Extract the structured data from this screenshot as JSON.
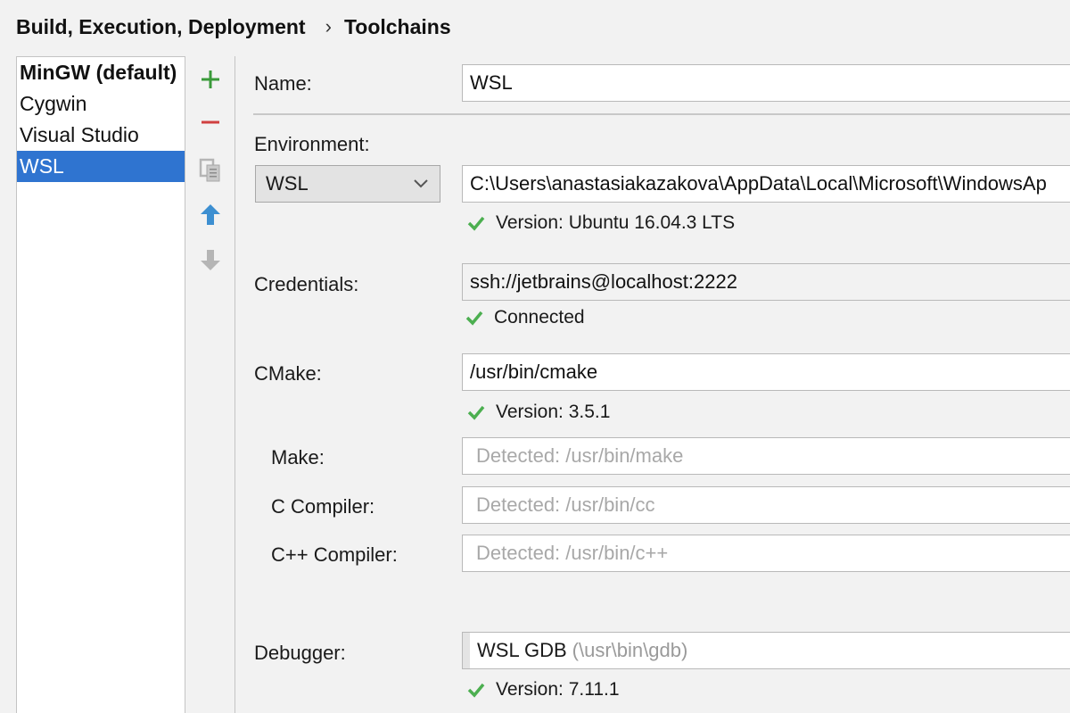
{
  "breadcrumb": {
    "parent": "Build, Execution, Deployment",
    "separator": "›",
    "current": "Toolchains"
  },
  "toolchains": [
    {
      "label": "MinGW (default)",
      "bold": true,
      "selected": false
    },
    {
      "label": "Cygwin",
      "bold": false,
      "selected": false
    },
    {
      "label": "Visual Studio",
      "bold": false,
      "selected": false
    },
    {
      "label": "WSL",
      "bold": false,
      "selected": true
    }
  ],
  "toolbar": {
    "add_icon": "plus-icon",
    "remove_icon": "minus-icon",
    "copy_icon": "copy-icon",
    "move_up_icon": "arrow-up-icon",
    "move_down_icon": "arrow-down-icon"
  },
  "form": {
    "name_label": "Name:",
    "name_value": "WSL",
    "environment_label": "Environment:",
    "environment_selected": "WSL",
    "environment_path": "C:\\Users\\anastasiakazakova\\AppData\\Local\\Microsoft\\WindowsAp",
    "environment_status": "Version: Ubuntu 16.04.3 LTS",
    "credentials_label": "Credentials:",
    "credentials_value": "ssh://jetbrains@localhost:2222",
    "credentials_status": "Connected",
    "cmake_label": "CMake:",
    "cmake_value": "/usr/bin/cmake",
    "cmake_status": "Version: 3.5.1",
    "make_label": "Make:",
    "make_placeholder": "Detected: /usr/bin/make",
    "c_compiler_label": "C Compiler:",
    "c_compiler_placeholder": "Detected: /usr/bin/cc",
    "cpp_compiler_label": "C++ Compiler:",
    "cpp_compiler_placeholder": "Detected: /usr/bin/c++",
    "debugger_label": "Debugger:",
    "debugger_value": "WSL GDB",
    "debugger_path": "(\\usr\\bin\\gdb)",
    "debugger_status": "Version: 7.11.1"
  },
  "colors": {
    "check": "#4caf50",
    "selection": "#2f74d0",
    "add": "#3a9a3a",
    "remove": "#d04040",
    "arrow_up": "#3d8fd1",
    "disabled": "#b5b5b5"
  }
}
